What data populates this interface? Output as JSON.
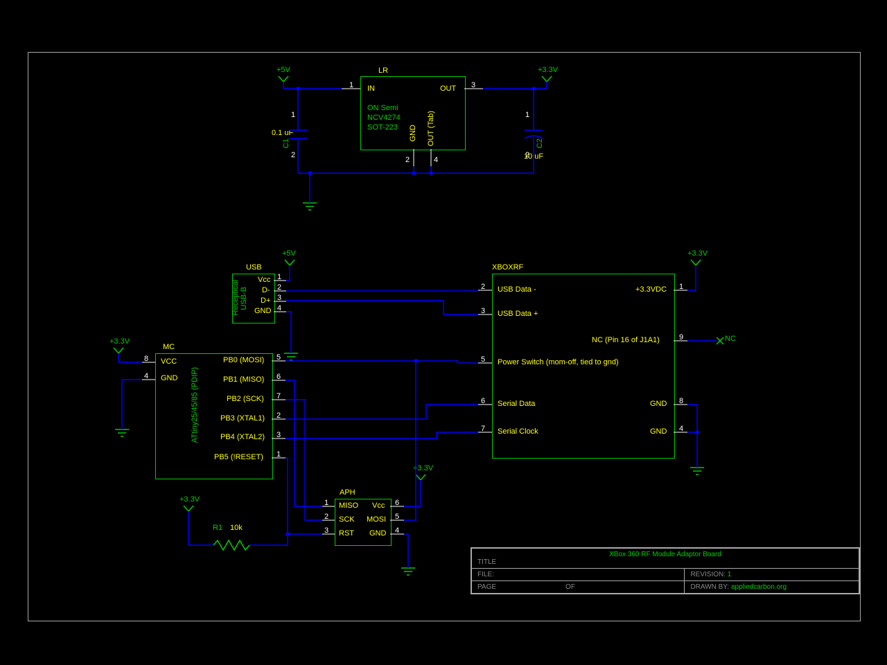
{
  "title": "XBox 360 RF Module Adaptor Board",
  "revision": "1",
  "drawn_by": "appliedcarbon.org",
  "labels": {
    "title_l": "TITLE",
    "file_l": "FILE:",
    "page_l": "PAGE",
    "of_l": "OF",
    "rev_l": "REVISION:",
    "drawn_l": "DRAWN BY:"
  },
  "power": {
    "p5v": "+5V",
    "p33v": "+3.3V"
  },
  "NC": "NC",
  "LR": {
    "des": "LR",
    "t1": "IN",
    "t2": "OUT",
    "t3": "ON Semi",
    "t4": "NCV4274",
    "t5": "SOT-223",
    "p_gnd": "GND",
    "p_out": "OUT (Tab)",
    "pin1": "1",
    "pin3": "3",
    "pin2": "2",
    "pin4": "4"
  },
  "C1": {
    "des": "C1",
    "val": "0.1 uF",
    "p1": "1",
    "p2": "2"
  },
  "C2": {
    "des": "C2",
    "val": "10 uF",
    "p1": "1",
    "p2": "2"
  },
  "USB": {
    "des": "USB",
    "sub": "USB-B",
    "sub2": "Receptical",
    "vcc": "Vcc",
    "dm": "D-",
    "dp": "D+",
    "gnd": "GND",
    "p1": "1",
    "p2": "2",
    "p3": "3",
    "p4": "4"
  },
  "MC": {
    "des": "MC",
    "part": "ATtiny25/45/85 (PDIP)",
    "vcc": "VCC",
    "gnd": "GND",
    "pb0": "PB0 (MOSI)",
    "pb1": "PB1 (MISO)",
    "pb2": "PB2 (SCK)",
    "pb3": "PB3 (XTAL1)",
    "pb4": "PB4 (XTAL2)",
    "pb5": "PB5 (!RESET)",
    "p8": "8",
    "p4": "4",
    "p5": "5",
    "p6": "6",
    "p7": "7",
    "p2": "2",
    "p3": "3",
    "p1": "1"
  },
  "APH": {
    "des": "APH",
    "miso": "MISO",
    "sck": "SCK",
    "rst": "RST",
    "vcc": "Vcc",
    "mosi": "MOSI",
    "gnd": "GND",
    "p1": "1",
    "p2": "2",
    "p3": "3",
    "p4": "4",
    "p5": "5",
    "p6": "6"
  },
  "R1": {
    "des": "R1",
    "val": "10k"
  },
  "XB": {
    "des": "XBOXRF",
    "udm": "USB Data -",
    "udp": "USB Data +",
    "nc": "NC (Pin 16 of J1A1)",
    "pwr": "Power Switch (mom-off, tied to gnd)",
    "sd": "Serial Data",
    "sc": "Serial Clock",
    "v33": "+3.3VDC",
    "gnd": "GND",
    "p2": "2",
    "p3": "3",
    "p5": "5",
    "p6": "6",
    "p7": "7",
    "p1": "1",
    "p9": "9",
    "p8": "8",
    "p4": "4"
  }
}
